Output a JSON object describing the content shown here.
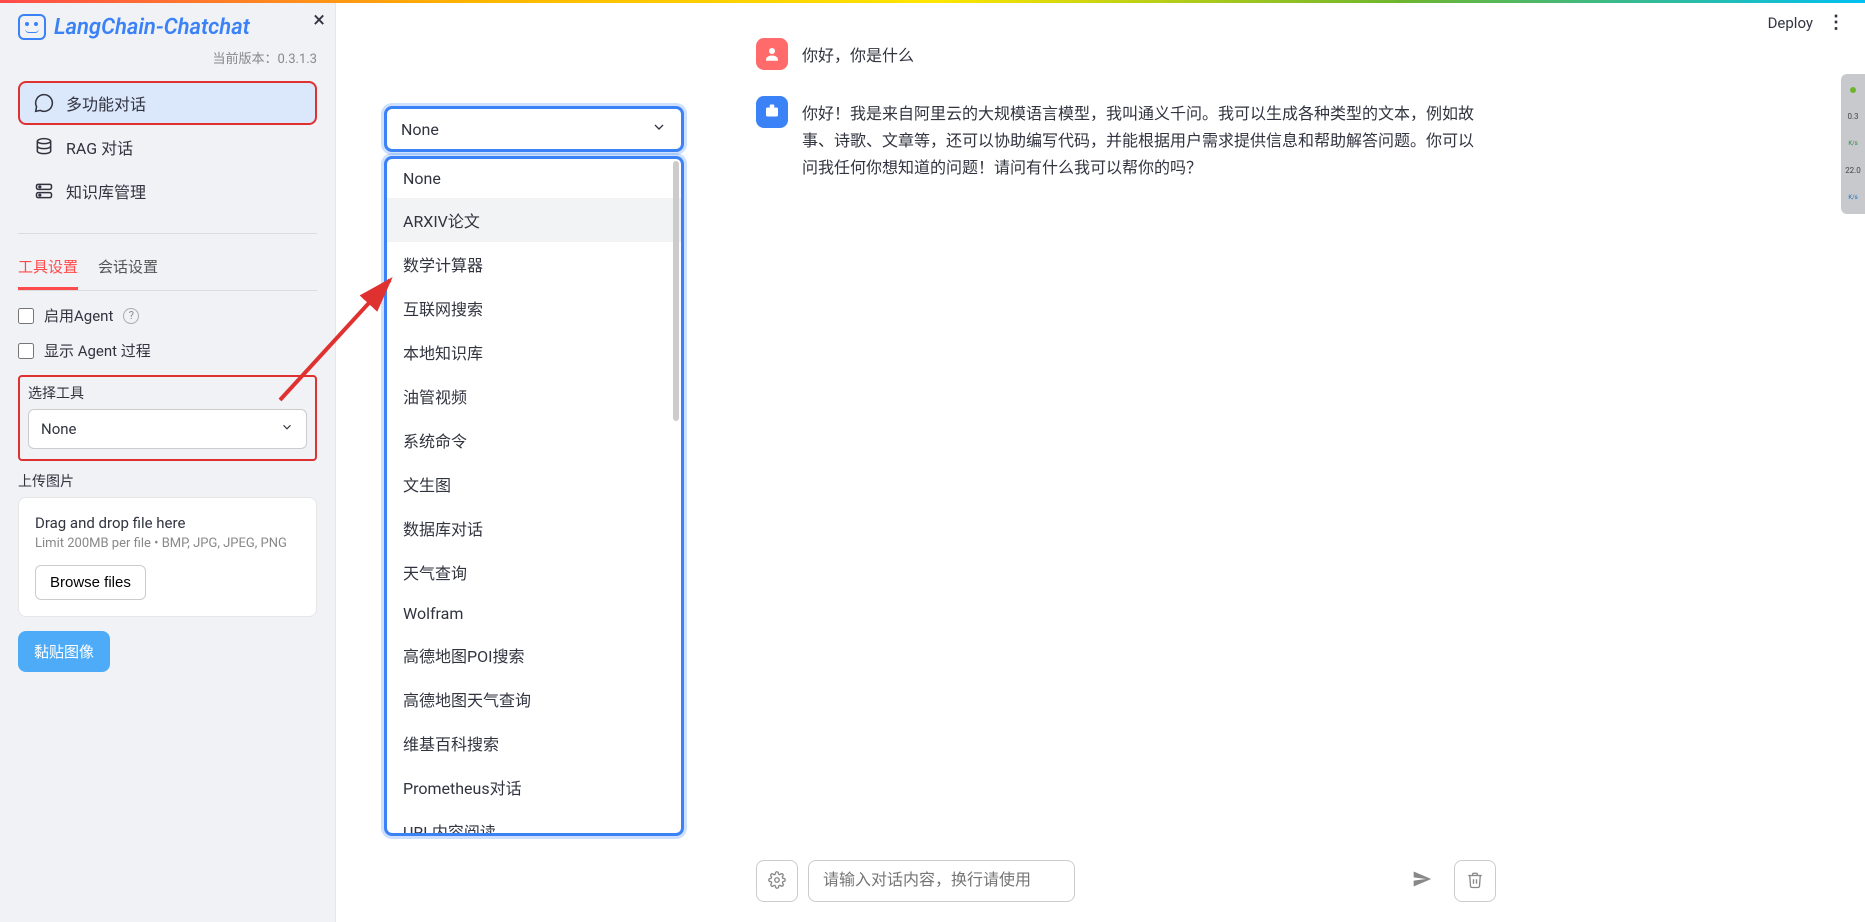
{
  "header": {
    "deploy": "Deploy"
  },
  "sidebar": {
    "logo_text": "LangChain-Chatchat",
    "version_label": "当前版本：",
    "version_value": "0.3.1.3",
    "nav": [
      {
        "label": "多功能对话",
        "active": true,
        "icon": "chat"
      },
      {
        "label": "RAG 对话",
        "active": false,
        "icon": "database"
      },
      {
        "label": "知识库管理",
        "active": false,
        "icon": "server"
      }
    ],
    "tabs": [
      {
        "label": "工具设置",
        "active": true
      },
      {
        "label": "会话设置",
        "active": false
      }
    ],
    "enable_agent_label": "启用Agent",
    "show_agent_process_label": "显示 Agent 过程",
    "select_tool_label": "选择工具",
    "select_tool_value": "None",
    "upload_label": "上传图片",
    "upload_title": "Drag and drop file here",
    "upload_hint": "Limit 200MB per file • BMP, JPG, JPEG, PNG",
    "browse_label": "Browse files",
    "paste_label": "黏贴图像"
  },
  "dropdown": {
    "selected": "None",
    "options": [
      "None",
      "ARXIV论文",
      "数学计算器",
      "互联网搜索",
      "本地知识库",
      "油管视频",
      "系统命令",
      "文生图",
      "数据库对话",
      "天气查询",
      "Wolfram",
      "高德地图POI搜索",
      "高德地图天气查询",
      "维基百科搜索",
      "Prometheus对话",
      "URL内容阅读"
    ]
  },
  "chat": {
    "user_text": "你好，你是什么",
    "assistant_text": "你好！我是来自阿里云的大规模语言模型，我叫通义千问。我可以生成各种类型的文本，例如故事、诗歌、文章等，还可以协助编写代码，并能根据用户需求提供信息和帮助解答问题。你可以问我任何你想知道的问题！请问有什么我可以帮你的吗？",
    "input_placeholder": "请输入对话内容，换行请使用Shift+Enter。"
  },
  "perf": {
    "top_value": "0.3",
    "top_unit": "K/s",
    "bottom_value": "22.0",
    "bottom_unit": "K/s"
  },
  "colors": {
    "accent_blue": "#3b82f6",
    "annotation_red": "#e03131",
    "streamlit_red": "#ff4b4b"
  }
}
